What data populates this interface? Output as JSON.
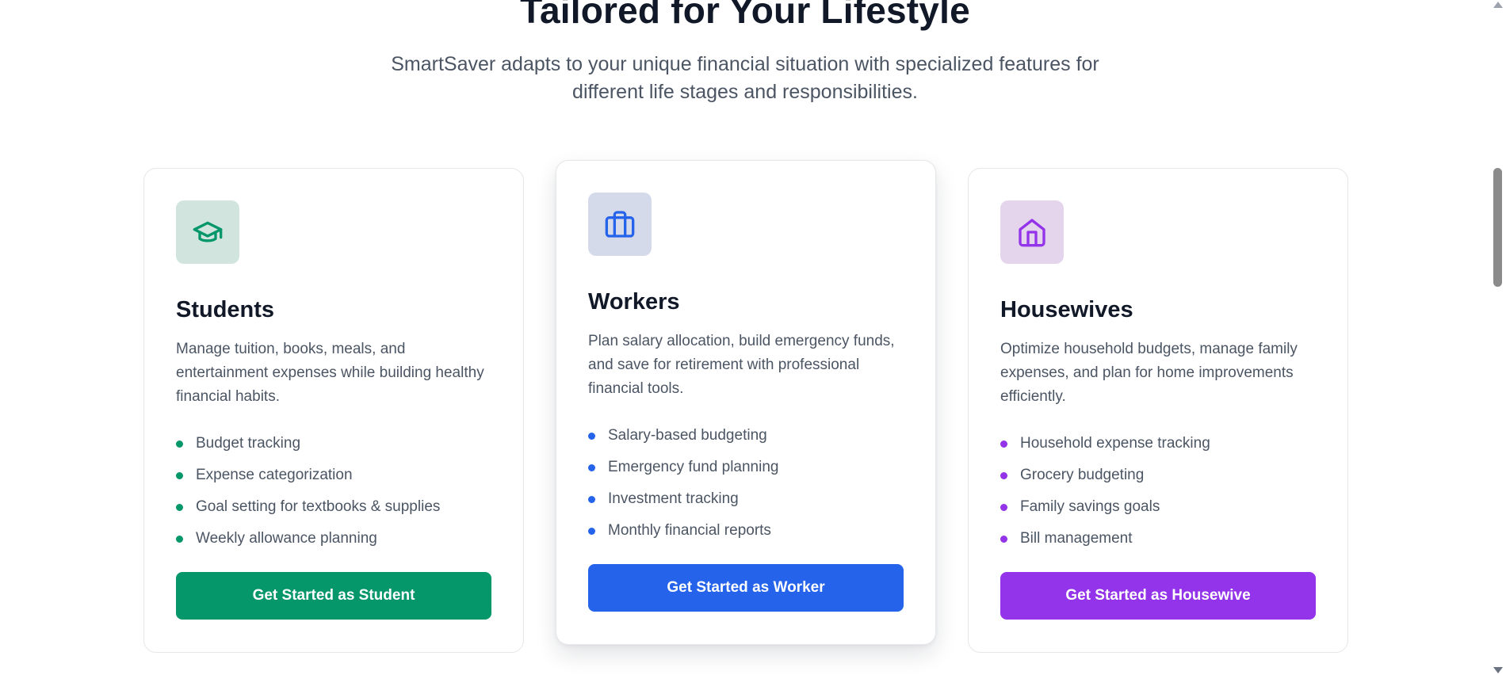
{
  "section": {
    "heading": "Tailored for Your Lifestyle",
    "subheading": "SmartSaver adapts to your unique financial situation with specialized features for different life stages and responsibilities."
  },
  "cards": [
    {
      "icon": "graduation-cap-icon",
      "accent": "#059669",
      "title": "Students",
      "description": "Manage tuition, books, meals, and entertainment expenses while building healthy financial habits.",
      "features": [
        "Budget tracking",
        "Expense categorization",
        "Goal setting for textbooks & supplies",
        "Weekly allowance planning"
      ],
      "cta": "Get Started as Student"
    },
    {
      "icon": "briefcase-icon",
      "accent": "#2563eb",
      "title": "Workers",
      "description": "Plan salary allocation, build emergency funds, and save for retirement with professional financial tools.",
      "features": [
        "Salary-based budgeting",
        "Emergency fund planning",
        "Investment tracking",
        "Monthly financial reports"
      ],
      "cta": "Get Started as Worker"
    },
    {
      "icon": "house-icon",
      "accent": "#9333ea",
      "title": "Housewives",
      "description": "Optimize household budgets, manage family expenses, and plan for home improvements efficiently.",
      "features": [
        "Household expense tracking",
        "Grocery budgeting",
        "Family savings goals",
        "Bill management"
      ],
      "cta": "Get Started as Housewive"
    }
  ]
}
